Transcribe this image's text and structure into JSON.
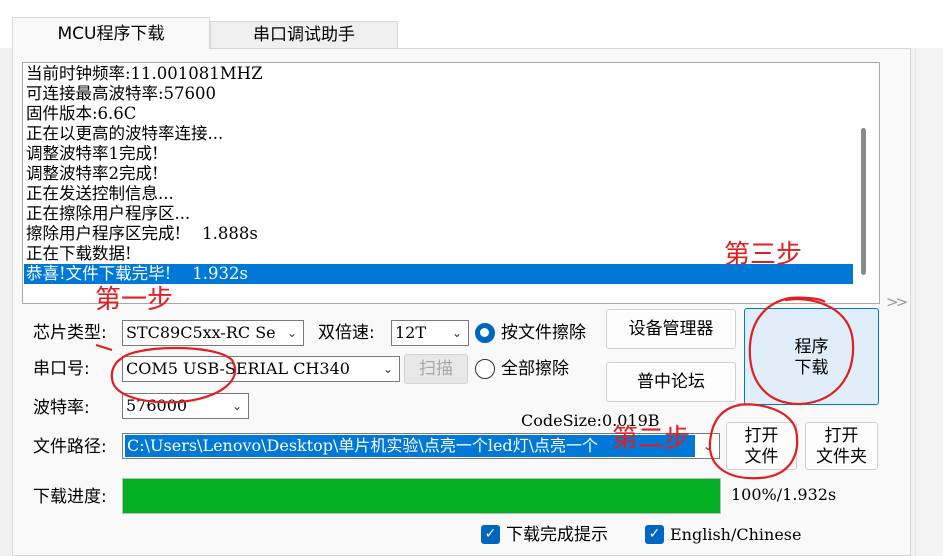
{
  "tabs": [
    {
      "label": "MCU程序下载",
      "active": true
    },
    {
      "label": "串口调试助手",
      "active": false
    }
  ],
  "log": {
    "lines": [
      "当前时钟频率:11.001081MHZ",
      "可连接最高波特率:57600",
      "固件版本:6.6C",
      "正在以更高的波特率连接...",
      "调整波特率1完成!",
      "调整波特率2完成!",
      "正在发送控制信息...",
      "正在擦除用户程序区...",
      "擦除用户程序区完成!    1.888s",
      "正在下载数据!",
      "恭喜!文件下载完毕!    1.932s"
    ],
    "selected_index": 10
  },
  "form": {
    "chip_label": "芯片类型:",
    "chip_value": "STC89C5xx-RC Se",
    "double_label": "双倍速:",
    "double_value": "12T",
    "erase_file_label": "按文件擦除",
    "erase_all_label": "全部擦除",
    "erase_mode": "file",
    "port_label": "串口号:",
    "port_value": "COM5  USB-SERIAL CH340",
    "scan_label": "扫描",
    "baud_label": "波特率:",
    "baud_value": "576000",
    "codesize": "CodeSize:0.019B",
    "path_label": "文件路径:",
    "path_value": "C:\\Users\\Lenovo\\Desktop\\单片机实验\\点亮一个led灯\\点亮一个",
    "progress_label": "下载进度:",
    "progress_fraction": 1.0,
    "progress_text": "100%/1.932s"
  },
  "buttons": {
    "device_manager": "设备管理器",
    "forum": "普中论坛",
    "program_line1": "程序",
    "program_line2": "下载",
    "open_file_line1": "打开",
    "open_file_line2": "文件",
    "open_folder_line1": "打开",
    "open_folder_line2": "文件夹"
  },
  "checkboxes": {
    "done_hint": {
      "label": "下载完成提示",
      "checked": true
    },
    "language": {
      "label": "English/Chinese",
      "checked": true
    }
  },
  "annotations": {
    "step1": "第一步",
    "step2": "第二步",
    "step3": "第三步",
    "color": "#e02020"
  },
  "colors": {
    "selection": "#0078d7",
    "progress": "#06b025",
    "accent": "#0067c0"
  }
}
